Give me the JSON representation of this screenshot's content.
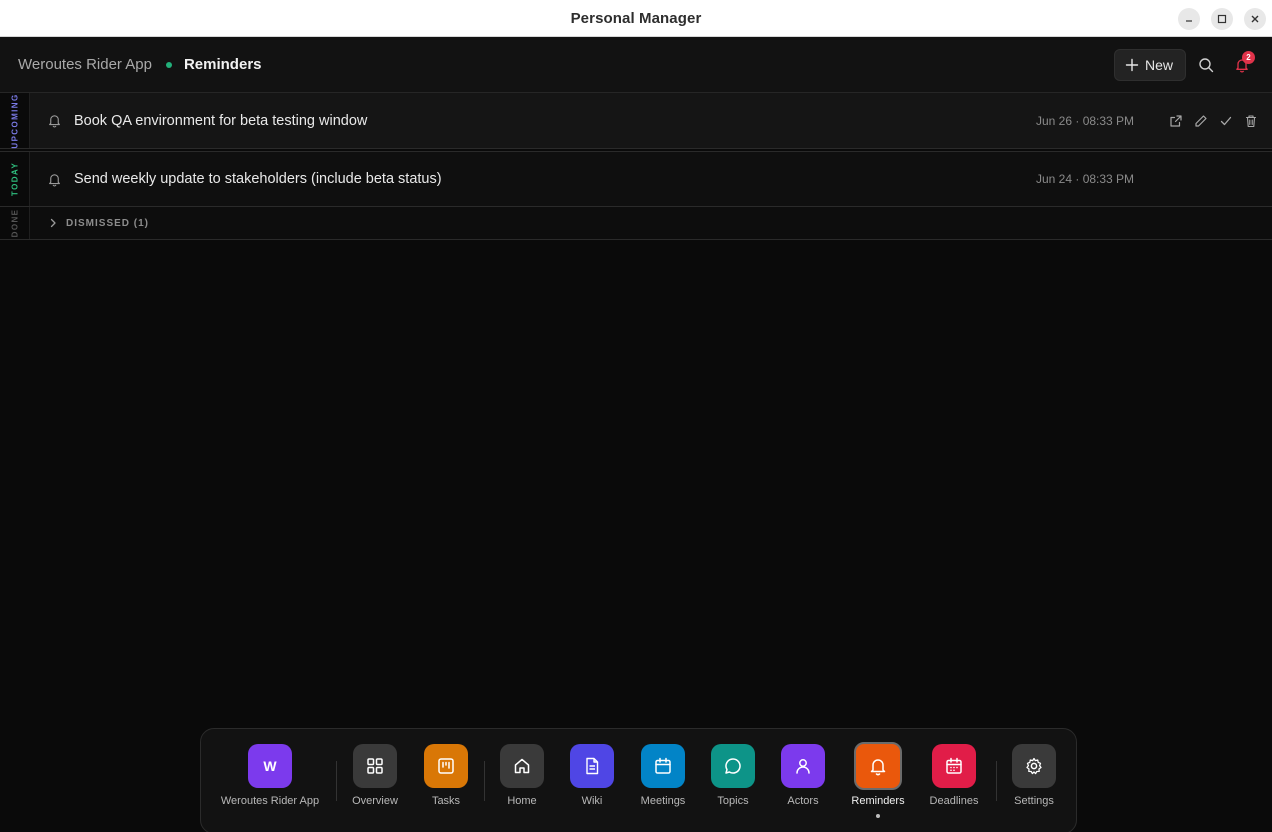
{
  "window": {
    "title": "Personal Manager"
  },
  "header": {
    "project": "Weroutes Rider App",
    "page": "Reminders",
    "new_label": "New",
    "notification_count": "2"
  },
  "sections": {
    "upcoming": {
      "label": "UPCOMING",
      "color": "#7b7be8",
      "reminder": {
        "text": "Book QA environment for beta testing window",
        "date": "Jun 26 · 08:33 PM"
      }
    },
    "today": {
      "label": "TODAY",
      "color": "#2fbf7f",
      "reminder": {
        "text": "Send weekly update to stakeholders (include beta status)",
        "date": "Jun 24 · 08:33 PM"
      }
    },
    "done": {
      "label": "DONE",
      "color": "#555555",
      "dismissed_label": "DISMISSED (1)"
    }
  },
  "dock": {
    "items": [
      {
        "label": "Weroutes Rider App",
        "icon": "project-avatar-icon",
        "letter": "W",
        "color": "#7c3aed"
      },
      {
        "label": "Overview",
        "icon": "grid-icon",
        "color": "#3a3a3a"
      },
      {
        "label": "Tasks",
        "icon": "kanban-icon",
        "color": "#d97706"
      },
      {
        "label": "Home",
        "icon": "home-icon",
        "color": "#3a3a3a"
      },
      {
        "label": "Wiki",
        "icon": "document-icon",
        "color": "#4f46e5"
      },
      {
        "label": "Meetings",
        "icon": "calendar-icon",
        "color": "#0284c7"
      },
      {
        "label": "Topics",
        "icon": "chat-bubble-icon",
        "color": "#0d9488"
      },
      {
        "label": "Actors",
        "icon": "user-icon",
        "color": "#7c3aed"
      },
      {
        "label": "Reminders",
        "icon": "bell-icon",
        "color": "#ea580c"
      },
      {
        "label": "Deadlines",
        "icon": "calendar-deadline-icon",
        "color": "#e11d48"
      },
      {
        "label": "Settings",
        "icon": "gear-icon",
        "color": "#3a3a3a"
      }
    ],
    "active": "Reminders"
  }
}
